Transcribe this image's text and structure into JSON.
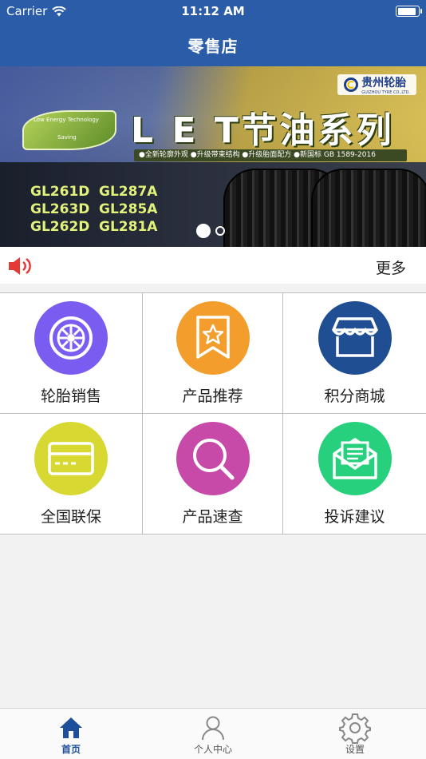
{
  "status_bar": {
    "carrier": "Carrier",
    "time": "11:12 AM",
    "battery_level": 0.92
  },
  "header": {
    "title": "零售店"
  },
  "banner": {
    "brand_name": "贵州轮胎",
    "brand_sub": "GUIZHOU TYRE CO.,LTD.",
    "leaf_lines": [
      "Low Energy Technology",
      "Saving"
    ],
    "slogan": "L E T节油系列",
    "features": "●全新轮廓外观 ●升级带束结构 ●升级胎面配方 ●新国标 GB 1589-2016",
    "models": [
      "GL261D",
      "GL287A",
      "GL263D",
      "GL285A",
      "GL262D",
      "GL281A"
    ],
    "pages": 2,
    "current_page": 1
  },
  "notice": {
    "more_label": "更多",
    "icon": "speaker-icon",
    "icon_color": "#e53935"
  },
  "grid": {
    "items": [
      {
        "label": "轮胎销售",
        "icon": "tire-icon",
        "color": "#7b5cf0"
      },
      {
        "label": "产品推荐",
        "icon": "star-ribbon-icon",
        "color": "#f29d2c"
      },
      {
        "label": "积分商城",
        "icon": "store-icon",
        "color": "#1f4e93"
      },
      {
        "label": "全国联保",
        "icon": "card-icon",
        "color": "#d8d833"
      },
      {
        "label": "产品速查",
        "icon": "search-icon",
        "color": "#c74aa8"
      },
      {
        "label": "投诉建议",
        "icon": "mail-icon",
        "color": "#26d07c"
      }
    ]
  },
  "tabbar": {
    "tabs": [
      {
        "label": "首页",
        "icon": "home-icon",
        "active": true
      },
      {
        "label": "个人中心",
        "icon": "user-icon",
        "active": false
      },
      {
        "label": "设置",
        "icon": "gear-icon",
        "active": false
      }
    ],
    "active_color": "#1e4f9a"
  },
  "colors": {
    "nav": "#2b5ca8",
    "background": "#f2f2f2"
  }
}
